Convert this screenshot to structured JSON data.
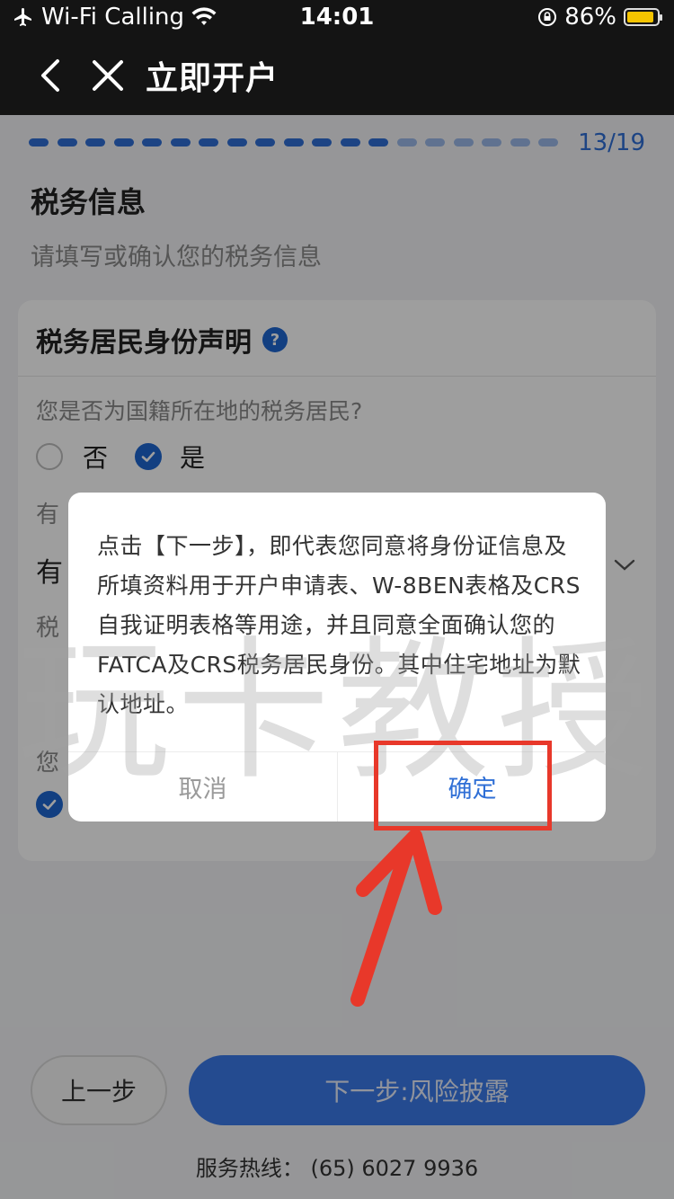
{
  "status_bar": {
    "carrier": "Wi-Fi Calling",
    "time": "14:01",
    "battery": "86%",
    "icons": [
      "airplane-icon",
      "wifi-icon",
      "orientation-lock-icon",
      "battery-icon"
    ]
  },
  "nav": {
    "title": "立即开户",
    "icons": [
      "back-chevron-icon",
      "close-icon"
    ]
  },
  "progress": {
    "current": 13,
    "total": 19,
    "label": "13/19",
    "colors": {
      "done": "#2f6fd6",
      "todo": "#9bb9e8"
    }
  },
  "section": {
    "title": "税务信息",
    "subtitle": "请填写或确认您的税务信息"
  },
  "card": {
    "title": "税务居民身份声明",
    "help_icon": "?",
    "question1": "您是否为国籍所在地的税务居民?",
    "option_no": "否",
    "option_yes": "是",
    "selected": "是",
    "partial_1": "有",
    "partial_2": "有",
    "partial_3": "税",
    "partial_4": "您"
  },
  "dialog": {
    "message": "点击【下一步】，即代表您同意将身份证信息及所填资料用于开户申请表、W-8BEN表格及CRS自我证明表格等用途，并且同意全面确认您的FATCA及CRS税务居民身份。其中住宅地址为默认地址。",
    "cancel_label": "取消",
    "confirm_label": "确定"
  },
  "footer": {
    "prev_label": "上一步",
    "next_label": "下一步:风险披露",
    "hotline": "服务热线：  (65) 6027 9936"
  },
  "watermark": "玩卡教授",
  "colors": {
    "accent": "#2f6fd6",
    "annotation": "#e8382a"
  }
}
